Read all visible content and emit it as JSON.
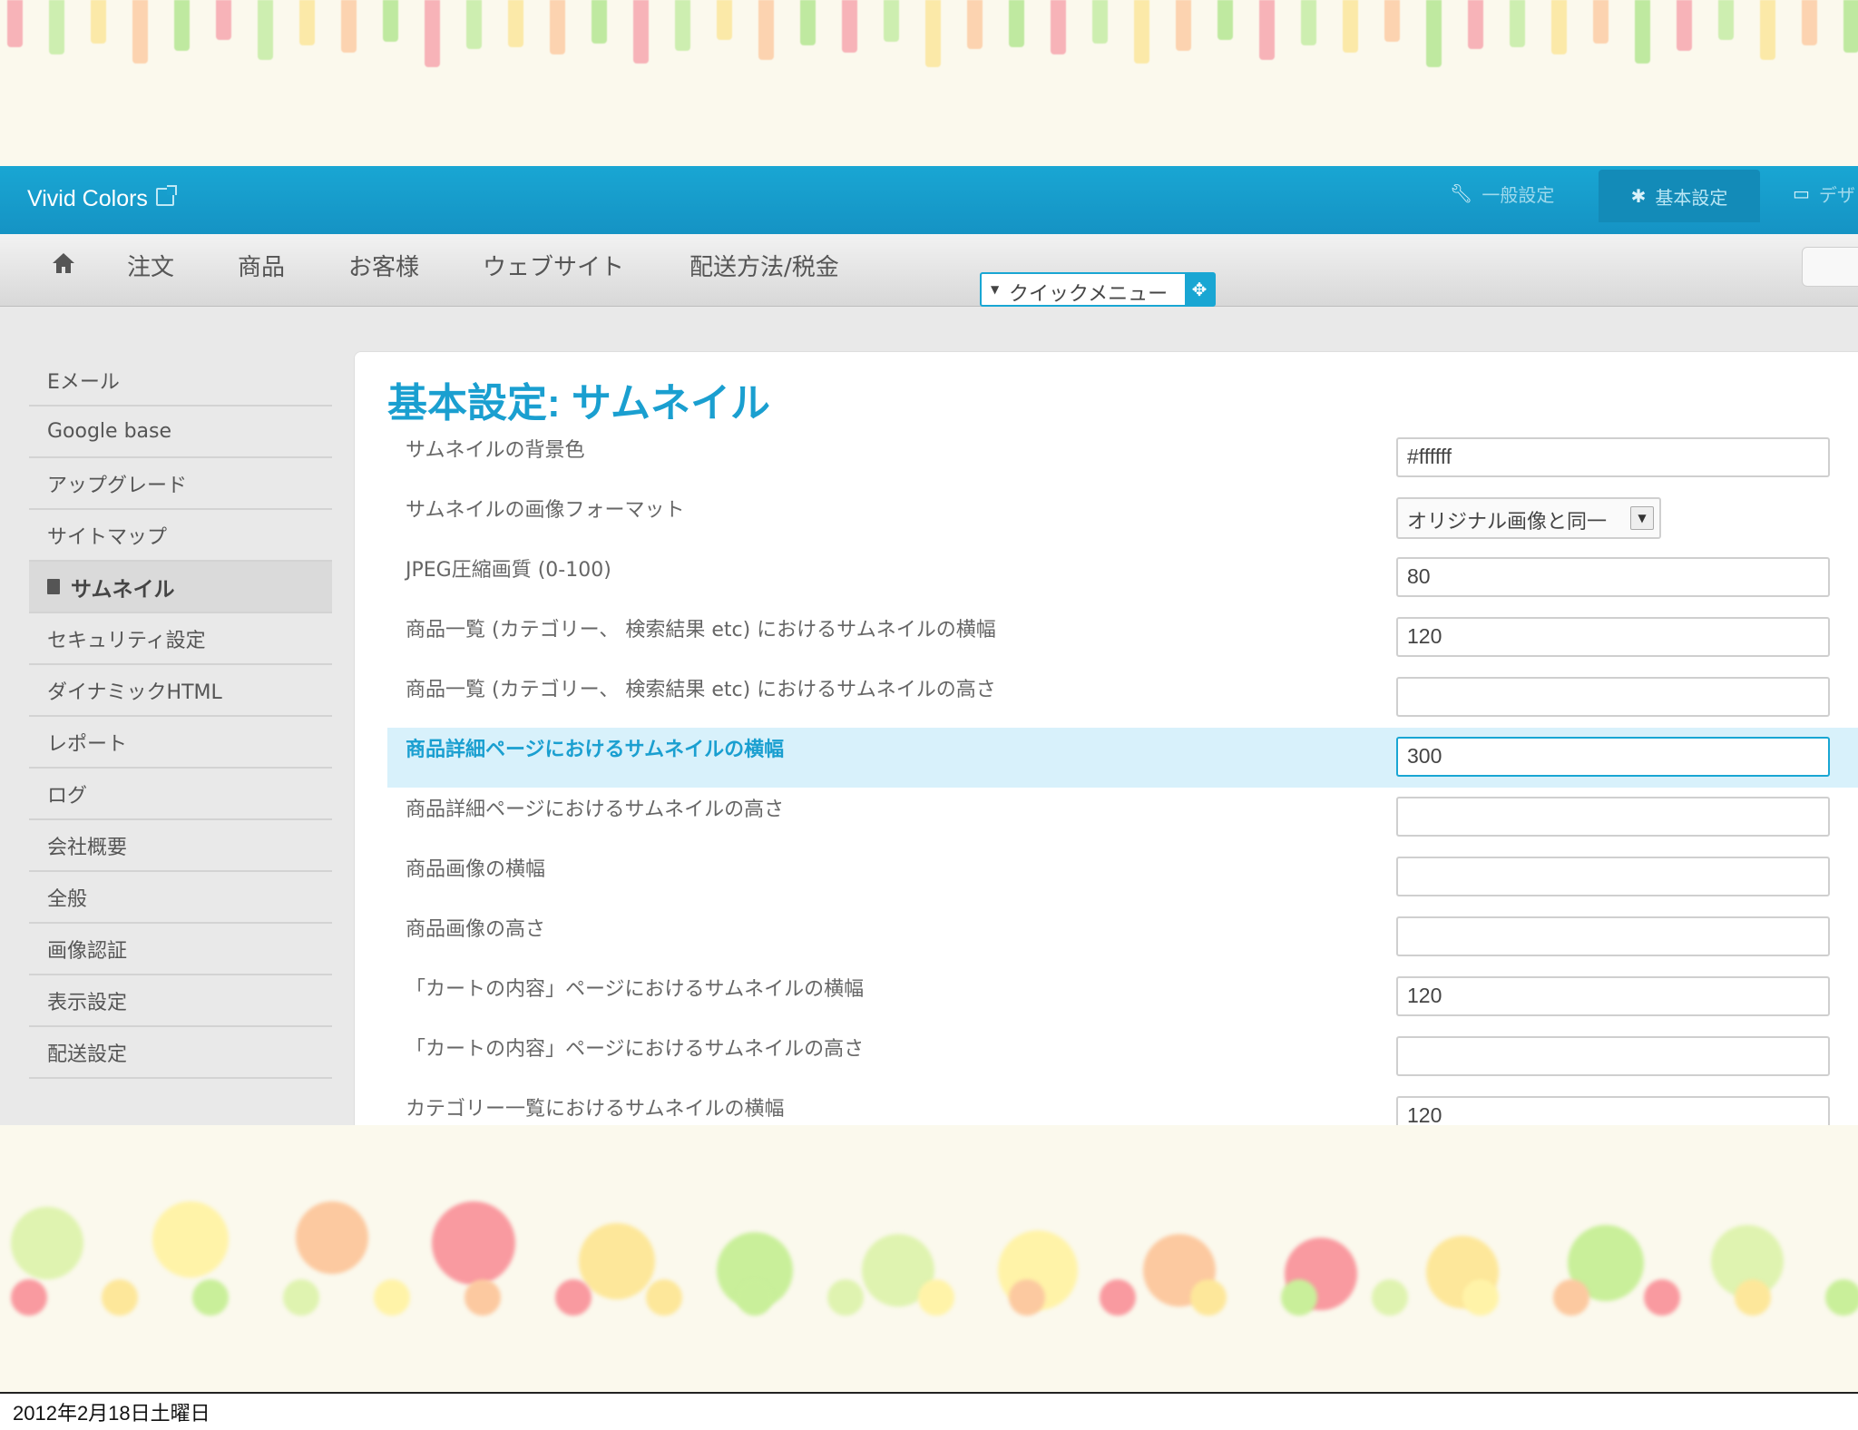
{
  "app": {
    "brand": "Vivid Colors",
    "top_tabs": [
      {
        "label": "一般設定",
        "icon": "wrench-icon"
      },
      {
        "label": "基本設定",
        "icon": "gear-icon"
      },
      {
        "label": "デザ",
        "icon": "monitor-icon"
      }
    ],
    "nav": [
      "注文",
      "商品",
      "お客様",
      "ウェブサイト",
      "配送方法/税金"
    ],
    "quick_menu": "クイックメニュー"
  },
  "sidebar": {
    "items": [
      {
        "label": "Eメール"
      },
      {
        "label": "Google base"
      },
      {
        "label": "アップグレード"
      },
      {
        "label": "サイトマップ"
      },
      {
        "label": "サムネイル"
      },
      {
        "label": "セキュリティ設定"
      },
      {
        "label": "ダイナミックHTML"
      },
      {
        "label": "レポート"
      },
      {
        "label": "ログ"
      },
      {
        "label": "会社概要"
      },
      {
        "label": "全般"
      },
      {
        "label": "画像認証"
      },
      {
        "label": "表示設定"
      },
      {
        "label": "配送設定"
      }
    ]
  },
  "main": {
    "title": "基本設定: サムネイル",
    "rows": [
      {
        "label": "サムネイルの背景色",
        "value": "#ffffff"
      },
      {
        "label": "サムネイルの画像フォーマット",
        "value": "オリジナル画像と同一"
      },
      {
        "label": "JPEG圧縮画質 (0-100)",
        "value": "80"
      },
      {
        "label": "商品一覧 (カテゴリー、 検索結果 etc) におけるサムネイルの横幅",
        "value": "120"
      },
      {
        "label": "商品一覧 (カテゴリー、 検索結果 etc) におけるサムネイルの高さ",
        "value": ""
      },
      {
        "label": "商品詳細ページにおけるサムネイルの横幅",
        "value": "300"
      },
      {
        "label": "商品詳細ページにおけるサムネイルの高さ",
        "value": ""
      },
      {
        "label": "商品画像の横幅",
        "value": ""
      },
      {
        "label": "商品画像の高さ",
        "value": ""
      },
      {
        "label": "「カートの内容」ページにおけるサムネイルの横幅",
        "value": "120"
      },
      {
        "label": "「カートの内容」ページにおけるサムネイルの高さ",
        "value": ""
      },
      {
        "label": "カテゴリー一覧におけるサムネイルの横幅",
        "value": "120"
      }
    ]
  },
  "caption": "2012年2月18日土曜日",
  "colors": {
    "accent": "#19a6d3",
    "highlight_row": "#d8f1fb",
    "stripe_palette": [
      "#f7b3b8",
      "#cdeeb0",
      "#fbe9a8",
      "#fcd3b0",
      "#bfe9a0"
    ],
    "dot_palette": [
      "#dff3b0",
      "#fff3a8",
      "#fcc9a0",
      "#f99aa0",
      "#fde79a",
      "#c9ef9a"
    ]
  }
}
